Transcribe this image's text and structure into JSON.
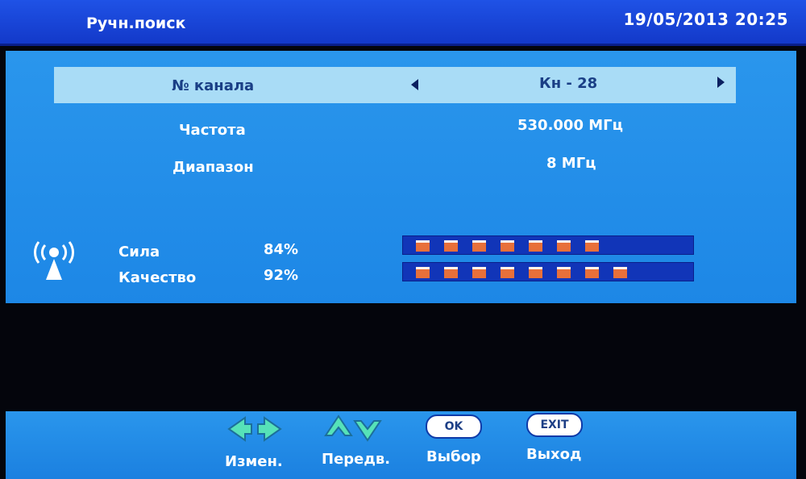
{
  "header": {
    "title": "Ручн.поиск",
    "datetime": "19/05/2013  20:25"
  },
  "fields": {
    "channel": {
      "label": "№ канала",
      "value": "Кн - 28"
    },
    "frequency": {
      "label": "Частота",
      "value": "530.000 МГц"
    },
    "bandwidth": {
      "label": "Диапазон",
      "value": "8 МГц"
    }
  },
  "signal": {
    "strength": {
      "label": "Сила",
      "percent_text": "84%",
      "level": 0.84
    },
    "quality": {
      "label": "Качество",
      "percent_text": "92%",
      "level": 0.92
    }
  },
  "help": {
    "change": {
      "label": "Измен.",
      "icon": "left-right-arrows-icon"
    },
    "move": {
      "label": "Передв.",
      "icon": "up-down-arrows-icon"
    },
    "ok": {
      "key": "OK",
      "label": "Выбор"
    },
    "exit": {
      "key": "EXIT",
      "label": "Выход"
    }
  },
  "colors": {
    "panel": "#1d87e6",
    "title_bar": "#1339c9",
    "selected_row": "#a9dcf6",
    "bar_fill": "#e8703a",
    "bar_track": "#1135b8"
  }
}
